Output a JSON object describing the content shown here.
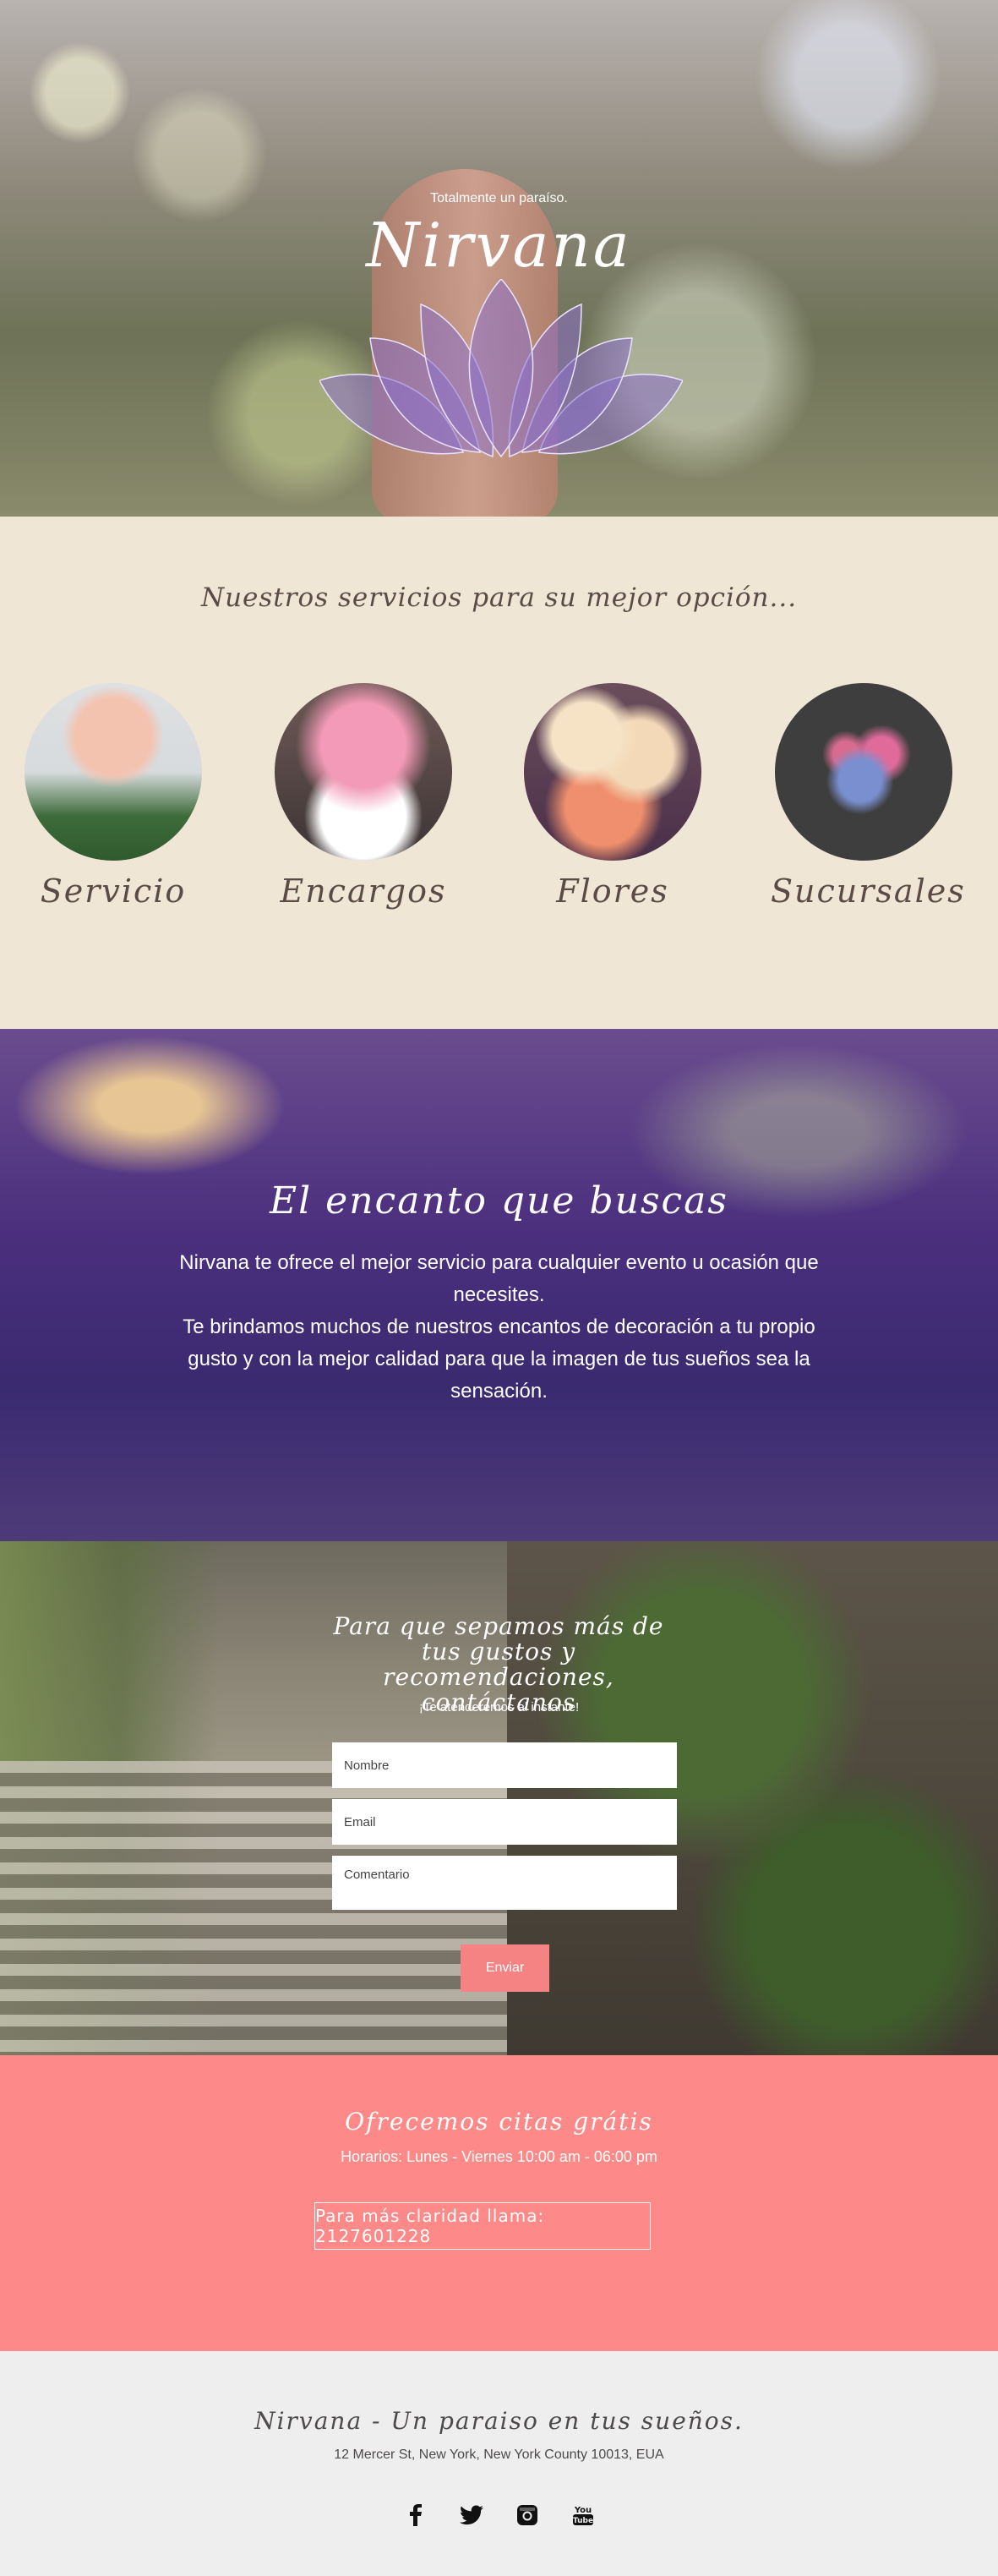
{
  "hero": {
    "tagline": "Totalmente un paraíso.",
    "title": "Nirvana",
    "logo": "lotus-logo"
  },
  "services": {
    "heading": "Nuestros servicios para su mejor opción...",
    "items": [
      {
        "label": "Servicio",
        "image": "pink-tulips"
      },
      {
        "label": "Encargos",
        "image": "flower-box-bouquet"
      },
      {
        "label": "Flores",
        "image": "roses-arrangement"
      },
      {
        "label": "Sucursales",
        "image": "blue-pink-flowers"
      }
    ]
  },
  "encanto": {
    "title": "El encanto que buscas",
    "line1": "Nirvana te ofrece el mejor servicio para cualquier evento u ocasión que necesites.",
    "line2": "Te brindamos muchos de nuestros encantos de decoración a tu propio gusto y con la mejor calidad para que la imagen de tus sueños sea la sensación."
  },
  "contact": {
    "title": "Para que sepamos más de tus gustos y recomendaciones, contáctanos",
    "subtitle": "¡Te atenderemos al instante!",
    "name_placeholder": "Nombre",
    "email_placeholder": "Email",
    "comment_placeholder": "Comentario",
    "send_label": "Enviar"
  },
  "citas": {
    "title": "Ofrecemos citas grátis",
    "hours": "Horarios: Lunes - Viernes 10:00 am - 06:00 pm",
    "cta": "Para más claridad llama: 2127601228"
  },
  "footer": {
    "title": "Nirvana - Un paraiso en tus sueños.",
    "address": "12 Mercer St, New York, New York County 10013, EUA",
    "socials": [
      "facebook-icon",
      "twitter-icon",
      "instagram-icon",
      "youtube-icon"
    ],
    "youtube_text": "You Tube"
  },
  "colors": {
    "cream": "#f0e6d6",
    "coral": "#fd8a89",
    "button": "#f58383",
    "lotus": "#8a6fc9"
  }
}
